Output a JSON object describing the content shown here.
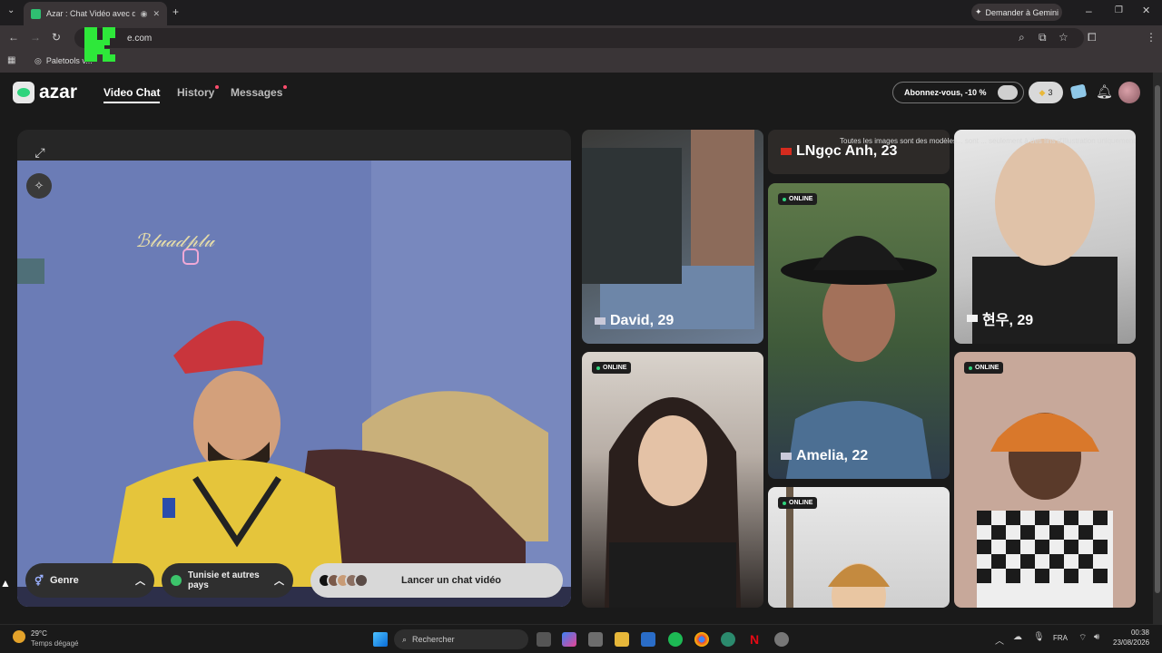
{
  "browser": {
    "tab_title": "Azar : Chat Vidéo avec de n",
    "address": "e.com",
    "bookmark": "Paletools v...",
    "gemini_label": "Demander à Gemini"
  },
  "header": {
    "logo_text": "azar",
    "nav": [
      "Video Chat",
      "History",
      "Messages"
    ],
    "subscribe_label": "Abonnez-vous, -10 %",
    "gems_count": "3"
  },
  "video": {
    "gender_label": "Genre",
    "region_label": "Tunisie et autres pays",
    "launch_label": "Lancer un chat vidéo"
  },
  "disclaimer": "Toutes les images sont des modèles... sont ... seulement à des fins d'illustration uniquement",
  "cards": [
    {
      "name": "David, 29",
      "online": false
    },
    {
      "name": "LNgọc Anh, 23",
      "online": false
    },
    {
      "name": "현우, 29",
      "online": false
    },
    {
      "name": "Amelia, 22",
      "online": true
    },
    {
      "name": "",
      "online": true
    },
    {
      "name": "",
      "online": true
    },
    {
      "name": "",
      "online": true
    }
  ],
  "online_label": "ONLINE",
  "taskbar": {
    "weather_temp": "29°C",
    "weather_desc": "Temps dégagé",
    "search_placeholder": "Rechercher",
    "lang": "FRA",
    "time": "00:38",
    "date": "23/08/2026"
  },
  "colors": {
    "accent": "#2fd47d",
    "badge_dot": "#ff4d6d"
  }
}
